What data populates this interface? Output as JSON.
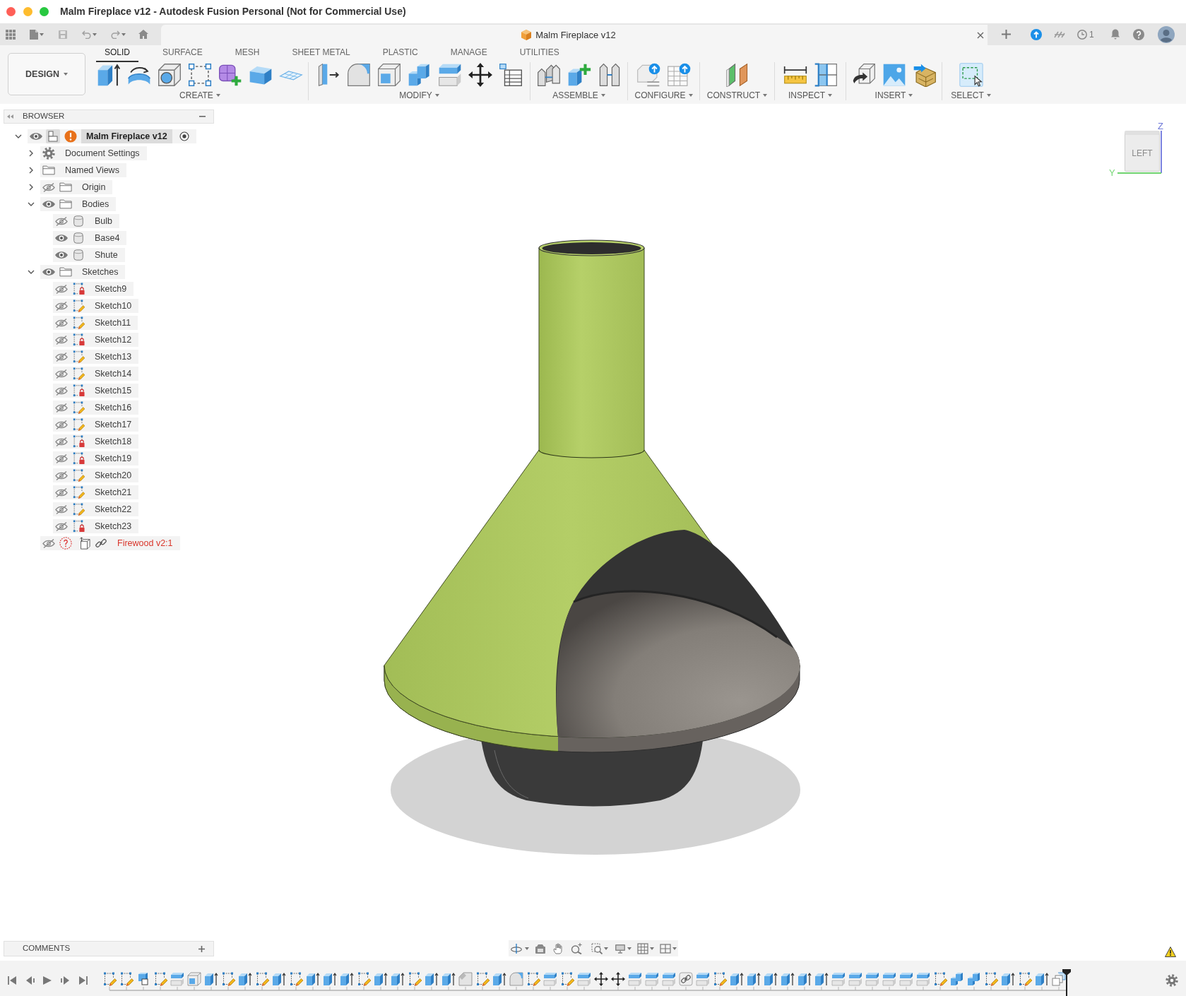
{
  "window": {
    "title": "Malm Fireplace v12 - Autodesk Fusion Personal (Not for Commercial Use)"
  },
  "document_tab": {
    "title": "Malm Fireplace v12"
  },
  "header": {
    "job_count": "1"
  },
  "workspace_button": {
    "label": "DESIGN"
  },
  "workspace_tabs": [
    {
      "label": "SOLID",
      "selected": true
    },
    {
      "label": "SURFACE",
      "selected": false
    },
    {
      "label": "MESH",
      "selected": false
    },
    {
      "label": "SHEET METAL",
      "selected": false
    },
    {
      "label": "PLASTIC",
      "selected": false
    },
    {
      "label": "MANAGE",
      "selected": false
    },
    {
      "label": "UTILITIES",
      "selected": false
    }
  ],
  "tool_groups": [
    {
      "label": "CREATE",
      "tools": [
        {
          "kind": "extrude"
        },
        {
          "kind": "revolve"
        },
        {
          "kind": "hole"
        },
        {
          "kind": "sketch"
        },
        {
          "kind": "form"
        },
        {
          "kind": "box"
        },
        {
          "kind": "mesh"
        }
      ]
    },
    {
      "label": "MODIFY",
      "tools": [
        {
          "kind": "press"
        },
        {
          "kind": "fillet"
        },
        {
          "kind": "shell"
        },
        {
          "kind": "combine"
        },
        {
          "kind": "split"
        },
        {
          "kind": "move"
        },
        {
          "kind": "table"
        }
      ]
    },
    {
      "label": "ASSEMBLE",
      "tools": [
        {
          "kind": "joint"
        },
        {
          "kind": "component"
        },
        {
          "kind": "pin"
        }
      ]
    },
    {
      "label": "CONFIGURE",
      "tools": [
        {
          "kind": "configure"
        },
        {
          "kind": "matrix"
        }
      ]
    },
    {
      "label": "CONSTRUCT",
      "tools": [
        {
          "kind": "planes"
        }
      ]
    },
    {
      "label": "INSPECT",
      "tools": [
        {
          "kind": "measure"
        },
        {
          "kind": "section"
        }
      ]
    },
    {
      "label": "INSERT",
      "tools": [
        {
          "kind": "derive"
        },
        {
          "kind": "image"
        },
        {
          "kind": "crate"
        }
      ]
    },
    {
      "label": "SELECT",
      "tools": [
        {
          "kind": "select"
        }
      ]
    }
  ],
  "browser": {
    "title": "BROWSER",
    "tree": [
      {
        "kind": "component",
        "label": "Malm Fireplace v12",
        "expanded": true,
        "visible": true,
        "warning": true,
        "active": true,
        "children": [
          {
            "kind": "settings",
            "label": "Document Settings",
            "expanded": false
          },
          {
            "kind": "folder",
            "label": "Named Views",
            "expanded": false
          },
          {
            "kind": "folder",
            "label": "Origin",
            "expanded": false,
            "visible": false
          },
          {
            "kind": "folder",
            "label": "Bodies",
            "expanded": true,
            "visible": true,
            "children": [
              {
                "kind": "body",
                "label": "Bulb",
                "visible": false
              },
              {
                "kind": "body",
                "label": "Base4",
                "visible": true
              },
              {
                "kind": "body",
                "label": "Shute",
                "visible": true
              }
            ]
          },
          {
            "kind": "folder",
            "label": "Sketches",
            "expanded": true,
            "visible": true,
            "children": [
              {
                "kind": "sketch",
                "label": "Sketch9",
                "visible": false,
                "locked": true
              },
              {
                "kind": "sketch",
                "label": "Sketch10",
                "visible": false,
                "locked": false
              },
              {
                "kind": "sketch",
                "label": "Sketch11",
                "visible": false,
                "locked": false
              },
              {
                "kind": "sketch",
                "label": "Sketch12",
                "visible": false,
                "locked": true
              },
              {
                "kind": "sketch",
                "label": "Sketch13",
                "visible": false,
                "locked": false
              },
              {
                "kind": "sketch",
                "label": "Sketch14",
                "visible": false,
                "locked": false
              },
              {
                "kind": "sketch",
                "label": "Sketch15",
                "visible": false,
                "locked": true
              },
              {
                "kind": "sketch",
                "label": "Sketch16",
                "visible": false,
                "locked": false
              },
              {
                "kind": "sketch",
                "label": "Sketch17",
                "visible": false,
                "locked": false
              },
              {
                "kind": "sketch",
                "label": "Sketch18",
                "visible": false,
                "locked": true
              },
              {
                "kind": "sketch",
                "label": "Sketch19",
                "visible": false,
                "locked": true
              },
              {
                "kind": "sketch",
                "label": "Sketch20",
                "visible": false,
                "locked": false
              },
              {
                "kind": "sketch",
                "label": "Sketch21",
                "visible": false,
                "locked": false
              },
              {
                "kind": "sketch",
                "label": "Sketch22",
                "visible": false,
                "locked": false
              },
              {
                "kind": "sketch",
                "label": "Sketch23",
                "visible": false,
                "locked": true
              }
            ]
          },
          {
            "kind": "component",
            "label": "Firewood v2:1",
            "visible": false,
            "missing": true,
            "linked": true
          }
        ]
      }
    ]
  },
  "view_cube": {
    "face": "LEFT",
    "z_label": "Z",
    "y_label": "Y"
  },
  "comments": {
    "title": "COMMENTS"
  },
  "timeline": {
    "features": [
      {
        "kind": "sketch"
      },
      {
        "kind": "sketch"
      },
      {
        "kind": "boundary"
      },
      {
        "kind": "sketch"
      },
      {
        "kind": "split"
      },
      {
        "kind": "shell"
      },
      {
        "kind": "extrude"
      },
      {
        "kind": "sketch"
      },
      {
        "kind": "extrude"
      },
      {
        "kind": "sketch"
      },
      {
        "kind": "extrude"
      },
      {
        "kind": "sketch"
      },
      {
        "kind": "extrude"
      },
      {
        "kind": "extrude"
      },
      {
        "kind": "extrude"
      },
      {
        "kind": "sketch"
      },
      {
        "kind": "extrude"
      },
      {
        "kind": "extrude"
      },
      {
        "kind": "sketch"
      },
      {
        "kind": "extrude"
      },
      {
        "kind": "extrude"
      },
      {
        "kind": "chamfer"
      },
      {
        "kind": "sketch"
      },
      {
        "kind": "extrude"
      },
      {
        "kind": "fillet"
      },
      {
        "kind": "sketch"
      },
      {
        "kind": "split"
      },
      {
        "kind": "sketch"
      },
      {
        "kind": "split"
      },
      {
        "kind": "move"
      },
      {
        "kind": "move"
      },
      {
        "kind": "split"
      },
      {
        "kind": "split"
      },
      {
        "kind": "split"
      },
      {
        "kind": "joint"
      },
      {
        "kind": "split"
      },
      {
        "kind": "sketch"
      },
      {
        "kind": "extrude"
      },
      {
        "kind": "extrude"
      },
      {
        "kind": "extrude"
      },
      {
        "kind": "extrude"
      },
      {
        "kind": "extrude"
      },
      {
        "kind": "extrude"
      },
      {
        "kind": "split"
      },
      {
        "kind": "split"
      },
      {
        "kind": "split"
      },
      {
        "kind": "split"
      },
      {
        "kind": "split"
      },
      {
        "kind": "split"
      },
      {
        "kind": "sketch"
      },
      {
        "kind": "combine"
      },
      {
        "kind": "combine"
      },
      {
        "kind": "sketch"
      },
      {
        "kind": "extrude"
      },
      {
        "kind": "sketch"
      },
      {
        "kind": "extrude"
      },
      {
        "kind": "pattern"
      }
    ]
  }
}
